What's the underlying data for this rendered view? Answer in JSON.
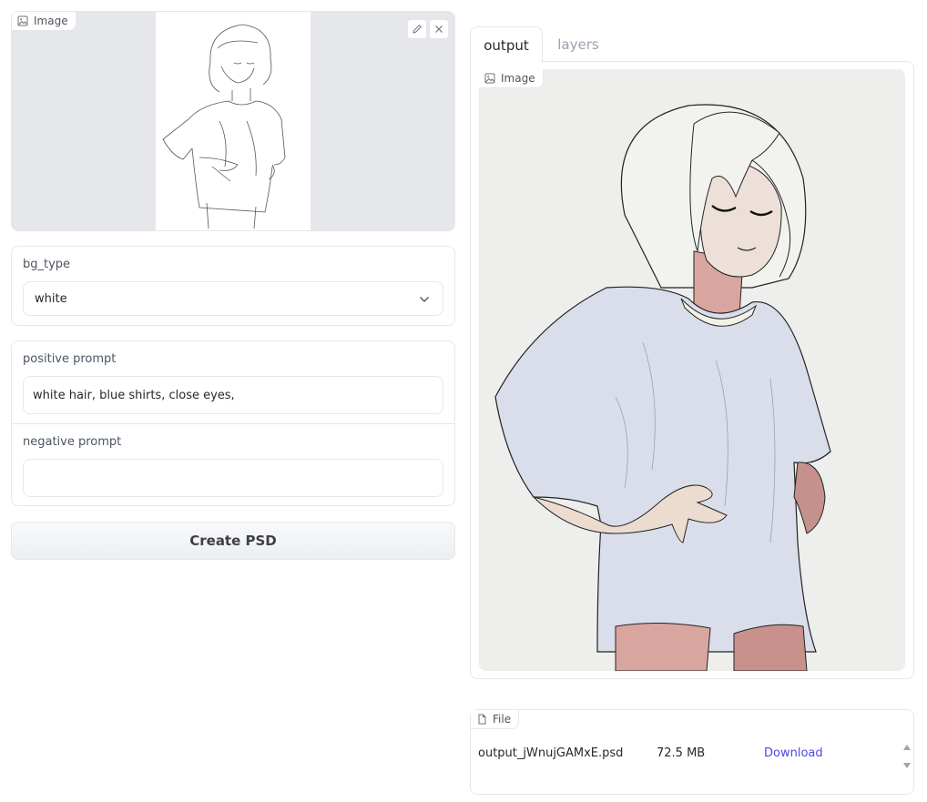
{
  "input_image": {
    "label": "Image",
    "edit_icon": "pencil-icon",
    "clear_icon": "close-icon"
  },
  "bg_type": {
    "label": "bg_type",
    "value": "white",
    "chevron_icon": "chevron-down-icon"
  },
  "prompts": {
    "positive_label": "positive prompt",
    "positive_value": "white hair, blue shirts, close eyes,",
    "negative_label": "negative prompt",
    "negative_value": ""
  },
  "create_button": "Create PSD",
  "tabs": [
    {
      "label": "output",
      "active": true
    },
    {
      "label": "layers",
      "active": false
    }
  ],
  "output_image": {
    "label": "Image"
  },
  "file": {
    "label": "File",
    "name": "output_jWnujGAMxE.psd",
    "size": "72.5 MB",
    "action": "Download"
  },
  "colors": {
    "accent_link": "#4f46e5",
    "panel_bg": "#e5e7eb",
    "border": "#e5e7eb"
  }
}
